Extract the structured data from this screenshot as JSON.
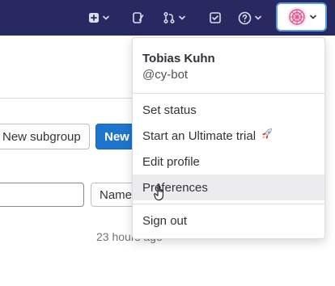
{
  "navbar": {
    "bg_color": "#292961",
    "icons": [
      "plus-square-icon",
      "issues-icon",
      "merge-request-icon",
      "todo-icon",
      "help-icon"
    ]
  },
  "page": {
    "new_subgroup_label": "New subgroup",
    "new_label": "New",
    "sort_label": "Name",
    "timestamp": "23 hours ago"
  },
  "user_menu": {
    "name": "Tobias Kuhn",
    "handle": "@cy-bot",
    "items": [
      {
        "label": "Set status"
      },
      {
        "label": "Start an Ultimate trial"
      },
      {
        "label": "Edit profile"
      },
      {
        "label": "Preferences",
        "hovered": true
      },
      {
        "label": "Sign out"
      }
    ],
    "hover_color": "#ececef"
  },
  "colors": {
    "primary_button": "#1f75cb",
    "avatar_focus_border": "#5b9ae0"
  }
}
